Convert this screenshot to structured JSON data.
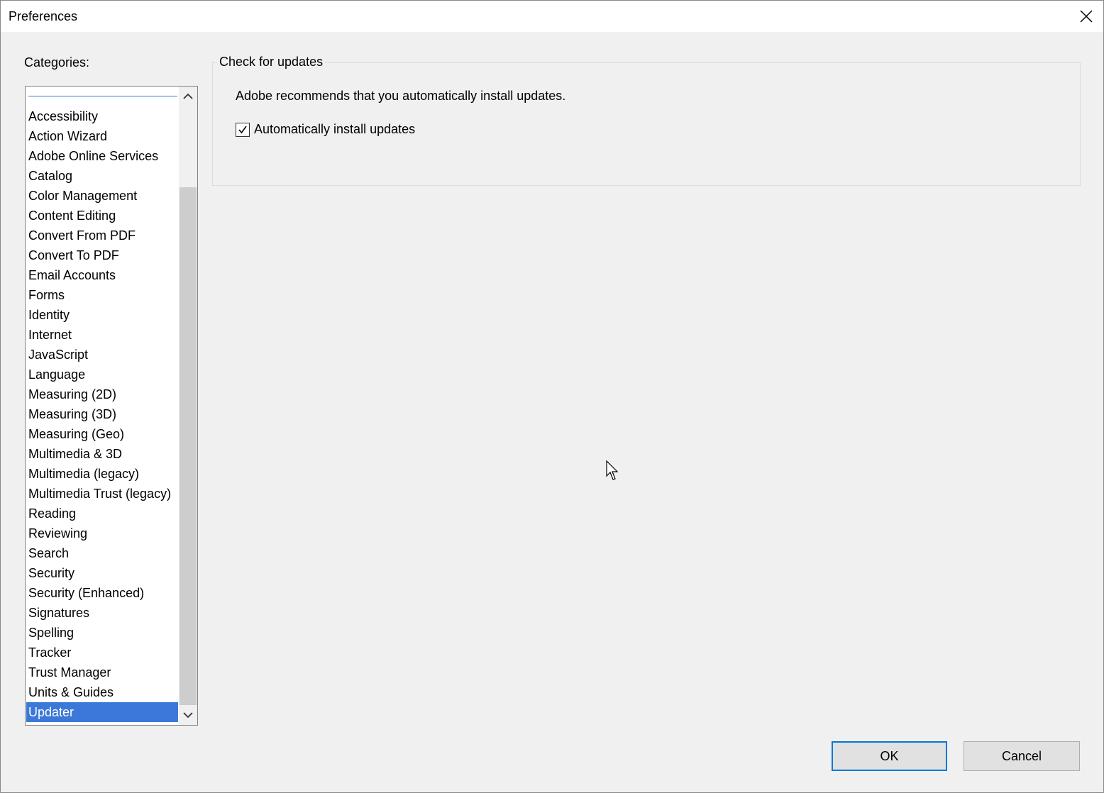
{
  "window": {
    "title": "Preferences"
  },
  "sidebar": {
    "label": "Categories:",
    "items": [
      "Accessibility",
      "Action Wizard",
      "Adobe Online Services",
      "Catalog",
      "Color Management",
      "Content Editing",
      "Convert From PDF",
      "Convert To PDF",
      "Email Accounts",
      "Forms",
      "Identity",
      "Internet",
      "JavaScript",
      "Language",
      "Measuring (2D)",
      "Measuring (3D)",
      "Measuring (Geo)",
      "Multimedia & 3D",
      "Multimedia (legacy)",
      "Multimedia Trust (legacy)",
      "Reading",
      "Reviewing",
      "Search",
      "Security",
      "Security (Enhanced)",
      "Signatures",
      "Spelling",
      "Tracker",
      "Trust Manager",
      "Units & Guides",
      "Updater"
    ],
    "selected": "Updater"
  },
  "main": {
    "group_title": "Check for updates",
    "description": "Adobe recommends that you automatically install updates.",
    "checkbox": {
      "label": "Automatically install updates",
      "checked": true
    }
  },
  "buttons": {
    "ok": "OK",
    "cancel": "Cancel"
  },
  "icons": {
    "close": "close-icon",
    "scroll_up": "chevron-up-icon",
    "scroll_down": "chevron-down-icon",
    "check": "checkmark-icon",
    "cursor": "mouse-pointer-icon"
  },
  "colors": {
    "selection": "#3c78d8",
    "focus_border": "#0078d7",
    "dialog_bg": "#f0f0f0"
  }
}
